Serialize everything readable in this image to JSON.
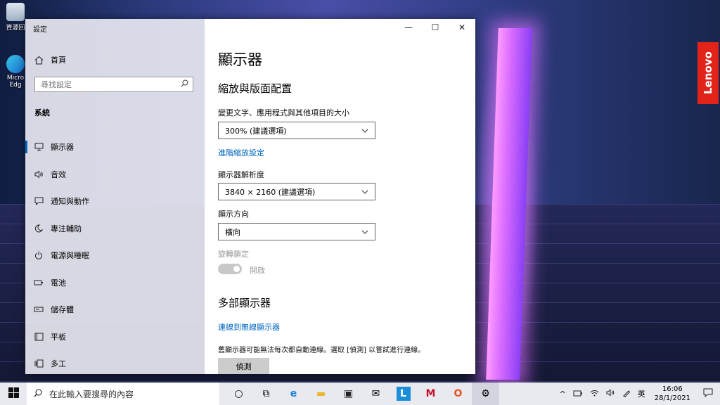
{
  "desktop": {
    "icons": [
      {
        "label": "資源回",
        "icon": "recycle-bin-icon"
      },
      {
        "label": "Micro Edg",
        "icon": "edge-icon"
      }
    ],
    "brand_badge": "Lenovo"
  },
  "window": {
    "title": "設定",
    "controls": {
      "minimize": "—",
      "maximize": "☐",
      "close": "✕"
    }
  },
  "sidebar": {
    "home_label": "首頁",
    "search_placeholder": "尋找設定",
    "section": "系統",
    "items": [
      {
        "label": "顯示器",
        "icon": "monitor-icon"
      },
      {
        "label": "音效",
        "icon": "speaker-icon"
      },
      {
        "label": "通知與動作",
        "icon": "notification-icon"
      },
      {
        "label": "專注輔助",
        "icon": "moon-icon"
      },
      {
        "label": "電源與睡眠",
        "icon": "power-icon"
      },
      {
        "label": "電池",
        "icon": "battery-icon"
      },
      {
        "label": "儲存體",
        "icon": "storage-icon"
      },
      {
        "label": "平板",
        "icon": "tablet-icon"
      },
      {
        "label": "多工",
        "icon": "multitask-icon"
      }
    ]
  },
  "main": {
    "title": "顯示器",
    "scale_heading": "縮放與版面配置",
    "scale_label": "變更文字、應用程式與其他項目的大小",
    "scale_value": "300% (建議選項)",
    "advanced_link": "進階縮放設定",
    "resolution_label": "顯示器解析度",
    "resolution_value": "3840 × 2160 (建議選項)",
    "orientation_label": "顯示方向",
    "orientation_value": "橫向",
    "rotation_lock_label": "旋轉鎖定",
    "rotation_lock_state": "開啟",
    "multi_heading": "多部顯示器",
    "wireless_link": "連線到無線顯示器",
    "detect_note": "舊顯示器可能無法每次都自動連線。選取 [偵測] 以嘗試進行連線。",
    "detect_button": "偵測"
  },
  "taskbar": {
    "search_placeholder": "在此輸入要搜尋的內容",
    "apps": [
      {
        "icon": "cortana-icon",
        "glyph": "○"
      },
      {
        "icon": "task-view-icon",
        "glyph": "⧉"
      },
      {
        "icon": "edge-icon",
        "glyph": "e"
      },
      {
        "icon": "file-explorer-icon",
        "glyph": "▬"
      },
      {
        "icon": "store-icon",
        "glyph": "▣"
      },
      {
        "icon": "mail-icon",
        "glyph": "✉"
      },
      {
        "icon": "lenovo-vantage-icon",
        "glyph": "L"
      },
      {
        "icon": "mcafee-icon",
        "glyph": "M"
      },
      {
        "icon": "office-icon",
        "glyph": "O"
      },
      {
        "icon": "settings-icon",
        "glyph": "⚙"
      }
    ],
    "tray": {
      "chevron": "^",
      "ime": "英",
      "time": "16:06",
      "date": "28/1/2021"
    }
  }
}
